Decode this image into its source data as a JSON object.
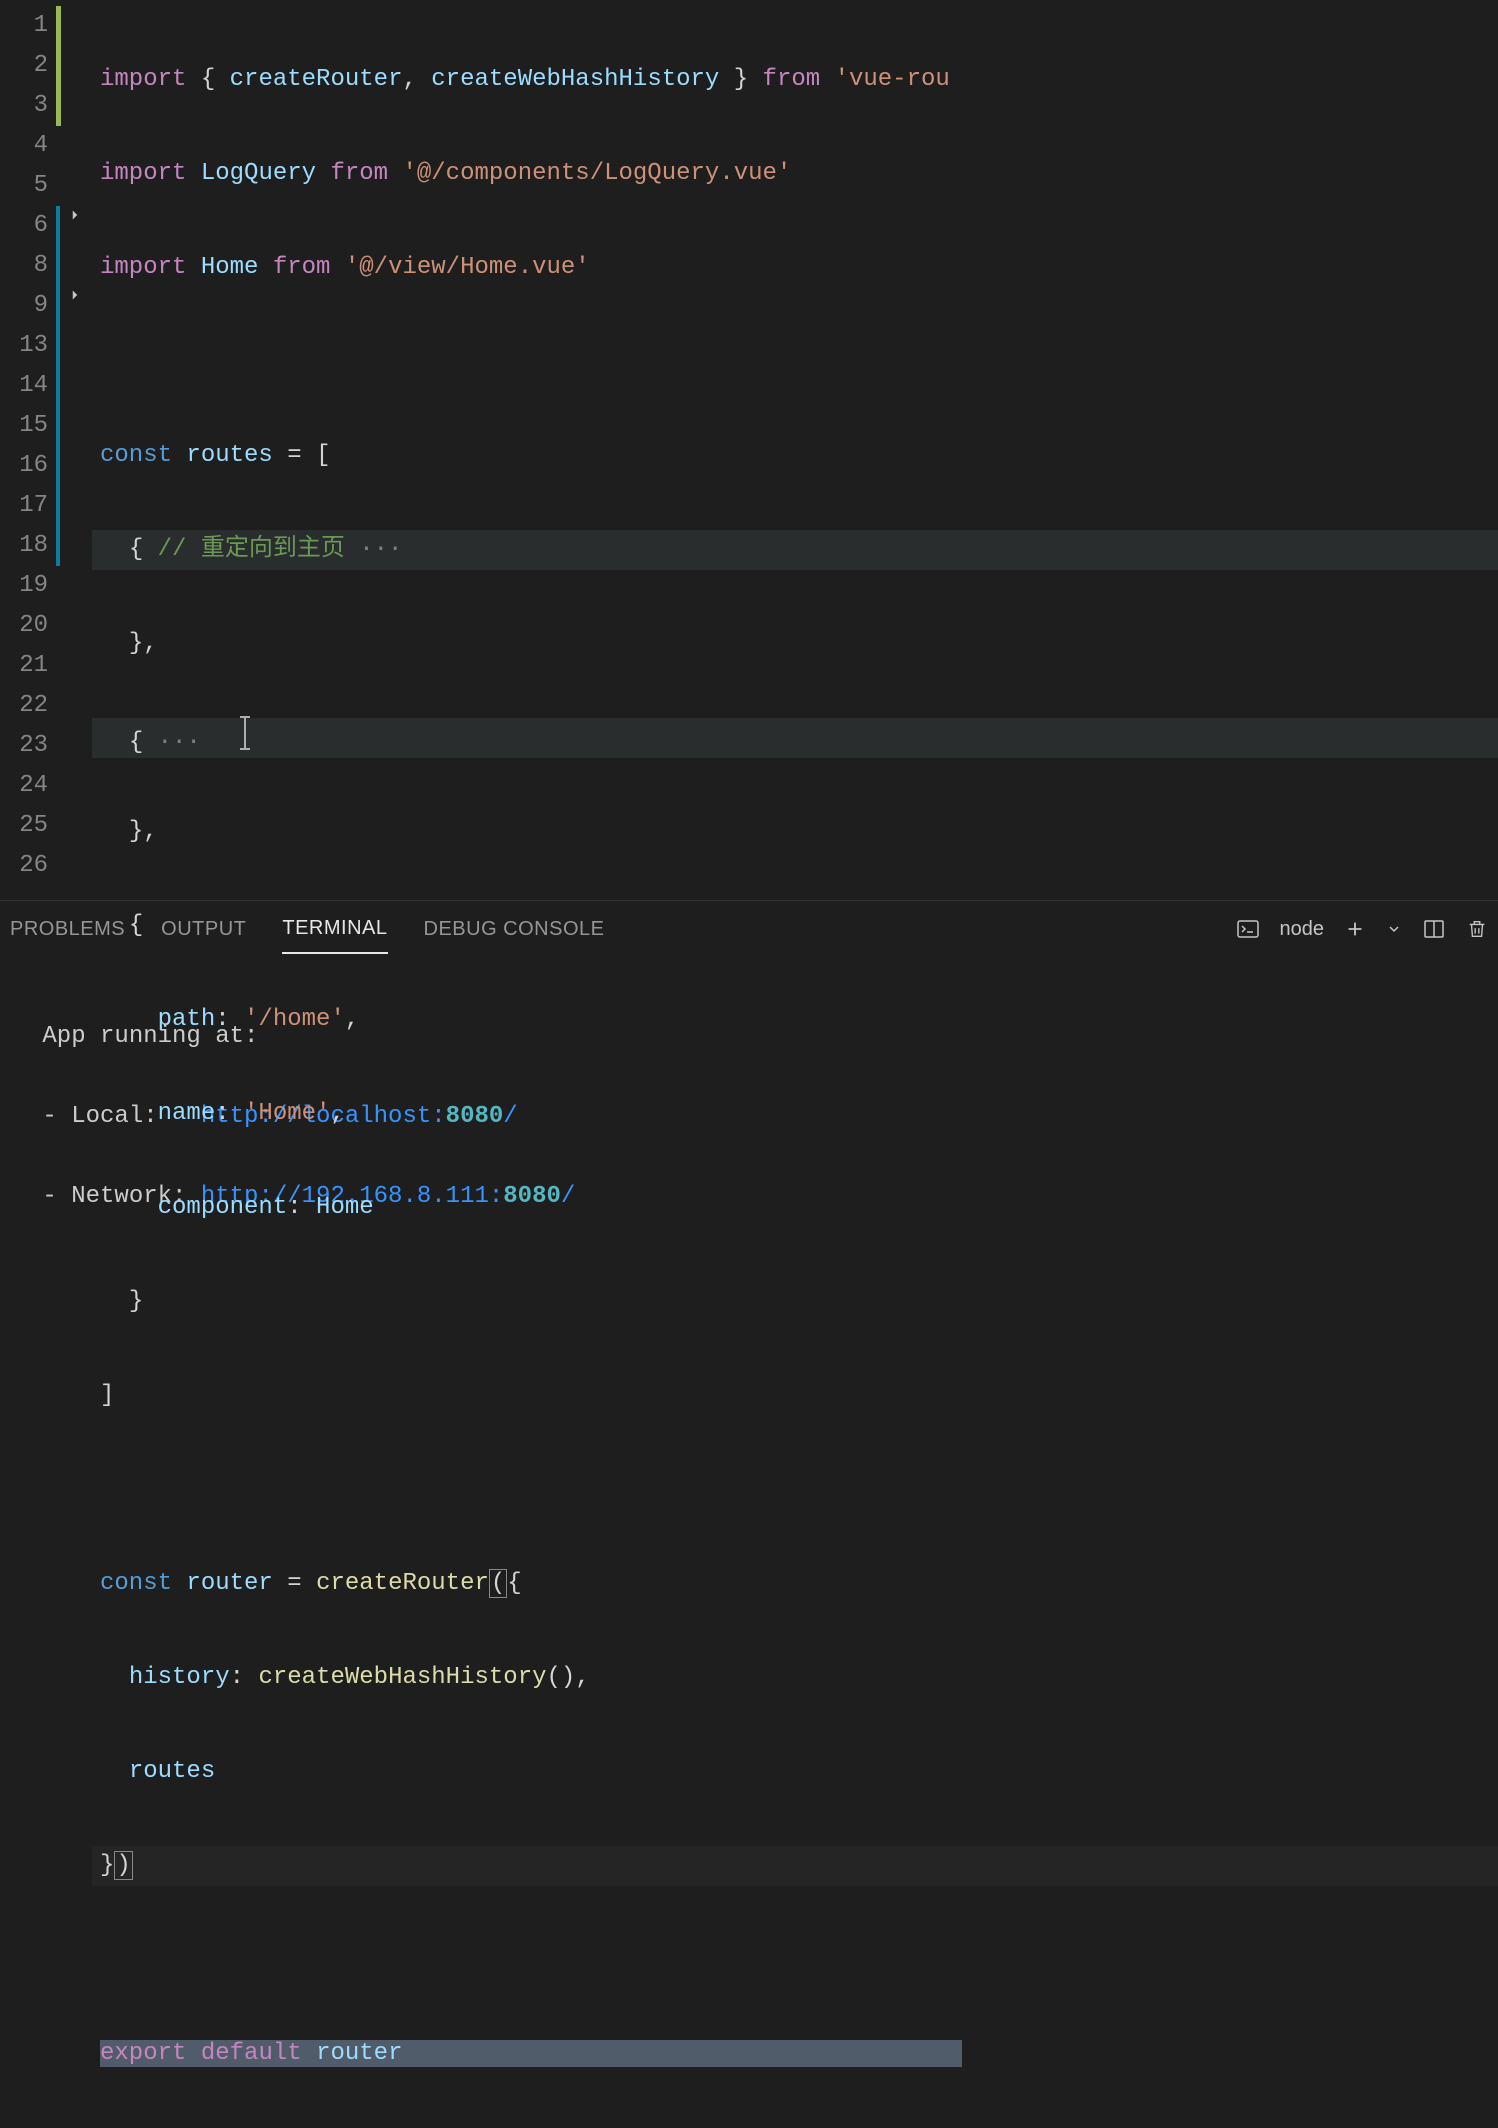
{
  "editor": {
    "lineNumbers": [
      "1",
      "2",
      "3",
      "4",
      "5",
      "6",
      "8",
      "9",
      "13",
      "14",
      "15",
      "16",
      "17",
      "18",
      "19",
      "20",
      "21",
      "22",
      "23",
      "24",
      "25",
      "26"
    ],
    "lines": {
      "l1": {
        "import": "import",
        "lb": "{ ",
        "id1": "createRouter",
        "c1": ", ",
        "id2": "createWebHashHistory",
        "rb": " }",
        "from": " from ",
        "str": "'vue-rou"
      },
      "l2": {
        "import": "import",
        "sp": " ",
        "id": "LogQuery",
        "from": " from ",
        "str": "'@/components/LogQuery.vue'"
      },
      "l3": {
        "import": "import",
        "sp": " ",
        "id": "Home",
        "from": " from ",
        "str": "'@/view/Home.vue'"
      },
      "l5": {
        "const": "const",
        "sp": " ",
        "id": "routes",
        "eq": " = ",
        "br": "["
      },
      "l6": {
        "indent": "  ",
        "lb": "{ ",
        "cmt": "// 重定向到主页",
        "ell": " ···"
      },
      "l8": {
        "indent": "  ",
        "rb": "},",
        "tail": ""
      },
      "l9": {
        "indent": "  ",
        "lb": "{",
        "ell": " ···"
      },
      "l13": {
        "indent": "  ",
        "rb": "},"
      },
      "l14": {
        "indent": "  ",
        "lb": "{"
      },
      "l15": {
        "indent": "    ",
        "key": "path",
        "c": ": ",
        "val": "'/home'",
        "cm": ","
      },
      "l16": {
        "indent": "    ",
        "key": "name",
        "c": ": ",
        "val": "'Home'",
        "cm": ","
      },
      "l17": {
        "indent": "    ",
        "key": "component",
        "c": ": ",
        "val": "Home"
      },
      "l18": {
        "indent": "  ",
        "rb": "}"
      },
      "l19": {
        "rb": "]"
      },
      "l21": {
        "const": "const",
        "sp": " ",
        "id": "router",
        "eq": " = ",
        "fn": "createRouter",
        "lp": "(",
        "lb": "{"
      },
      "l22": {
        "indent": "  ",
        "key": "history",
        "c": ": ",
        "fn": "createWebHashHistory",
        "lp": "(",
        "rp": ")",
        "cm": ","
      },
      "l23": {
        "indent": "  ",
        "id": "routes"
      },
      "l24": {
        "rb": "}",
        "rp": ")"
      },
      "l26": {
        "export": "export",
        "sp": " ",
        "default": "default",
        "sp2": " ",
        "id": "router"
      }
    }
  },
  "panel": {
    "tabs": {
      "problems": "PROBLEMS",
      "output": "OUTPUT",
      "terminal": "TERMINAL",
      "debug": "DEBUG CONSOLE"
    },
    "terminalLabel": "node"
  },
  "terminal": {
    "line1": " App running at:",
    "line2a": " - Local:   ",
    "url1": "http://localhost:",
    "port1": "8080",
    "slash1": "/",
    "line3a": " - Network: ",
    "url2": "http://192.168.8.111:",
    "port2": "8080",
    "slash2": "/"
  }
}
